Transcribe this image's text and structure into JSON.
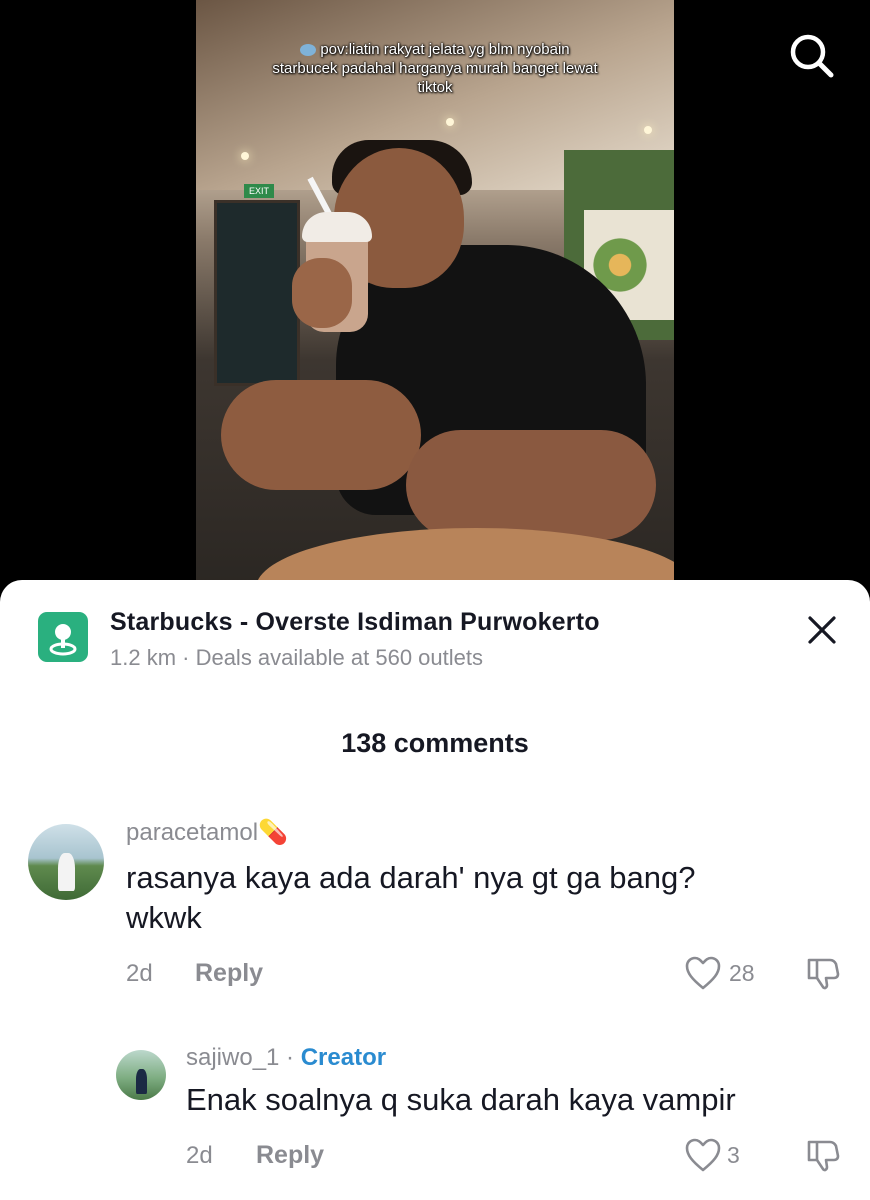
{
  "video": {
    "caption_line1": "pov:liatin rakyat jelata yg blm nyobain",
    "caption_line2": "starbucek padahal harganya murah banget lewat",
    "caption_line3": "tiktok",
    "exit_sign": "EXIT"
  },
  "poi": {
    "name": "Starbucks - Overste Isdiman Purwokerto",
    "subtitle": "1.2 km · Deals available at 560 outlets"
  },
  "comments_header": {
    "count_label": "138 comments"
  },
  "comments": [
    {
      "username": "paracetamol💊",
      "text_line1": "rasanya kaya ada darah' nya gt ga bang?",
      "text_line2": "wkwk",
      "age": "2d",
      "reply_label": "Reply",
      "likes": "28"
    },
    {
      "username": "sajiwo_1",
      "separator": " · ",
      "badge": "Creator",
      "text": "Enak soalnya q suka darah kaya vampir",
      "age": "2d",
      "reply_label": "Reply",
      "likes": "3"
    }
  ],
  "colors": {
    "accent_green": "#2ab07f",
    "creator_blue": "#2a8bd0",
    "text_dark": "#161823",
    "text_muted": "#8a8b91"
  },
  "icons": [
    "search-icon",
    "location-pin-icon",
    "close-icon",
    "heart-icon",
    "dislike-icon",
    "caption-emoji-icon"
  ]
}
